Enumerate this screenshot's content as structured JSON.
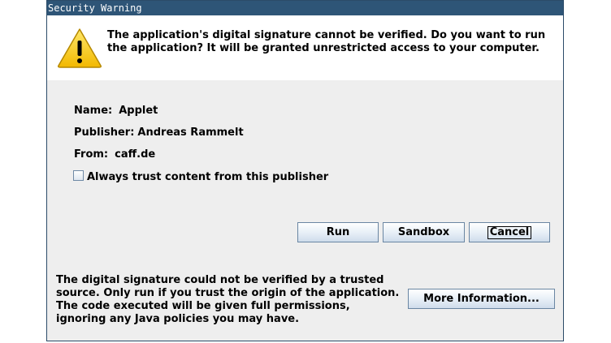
{
  "window": {
    "title": "Security Warning"
  },
  "header": {
    "icon": "warning-triangle-icon",
    "message": "The application's digital signature cannot be verified. Do you want to run the application? It will be granted unrestricted access to your computer."
  },
  "details": {
    "name_label": "Name:",
    "name_value": "Applet",
    "publisher_label": "Publisher:",
    "publisher_value": "Andreas Rammelt",
    "from_label": "From:",
    "from_value": "caff.de"
  },
  "trust_checkbox": {
    "label": "Always trust content from this publisher",
    "checked": false
  },
  "buttons": {
    "run": "Run",
    "sandbox": "Sandbox",
    "cancel": "Cancel",
    "more_info": "More Information..."
  },
  "footer": {
    "message": "The digital signature could not be verified by a trusted source. Only run if you trust the origin of the application. The code executed will be given full permissions, ignoring any Java policies you may have."
  },
  "colors": {
    "titlebar": "#2e5577",
    "dialog_bg": "#eeeeee",
    "header_bg": "#ffffff",
    "warning_yellow": "#f5c400"
  }
}
